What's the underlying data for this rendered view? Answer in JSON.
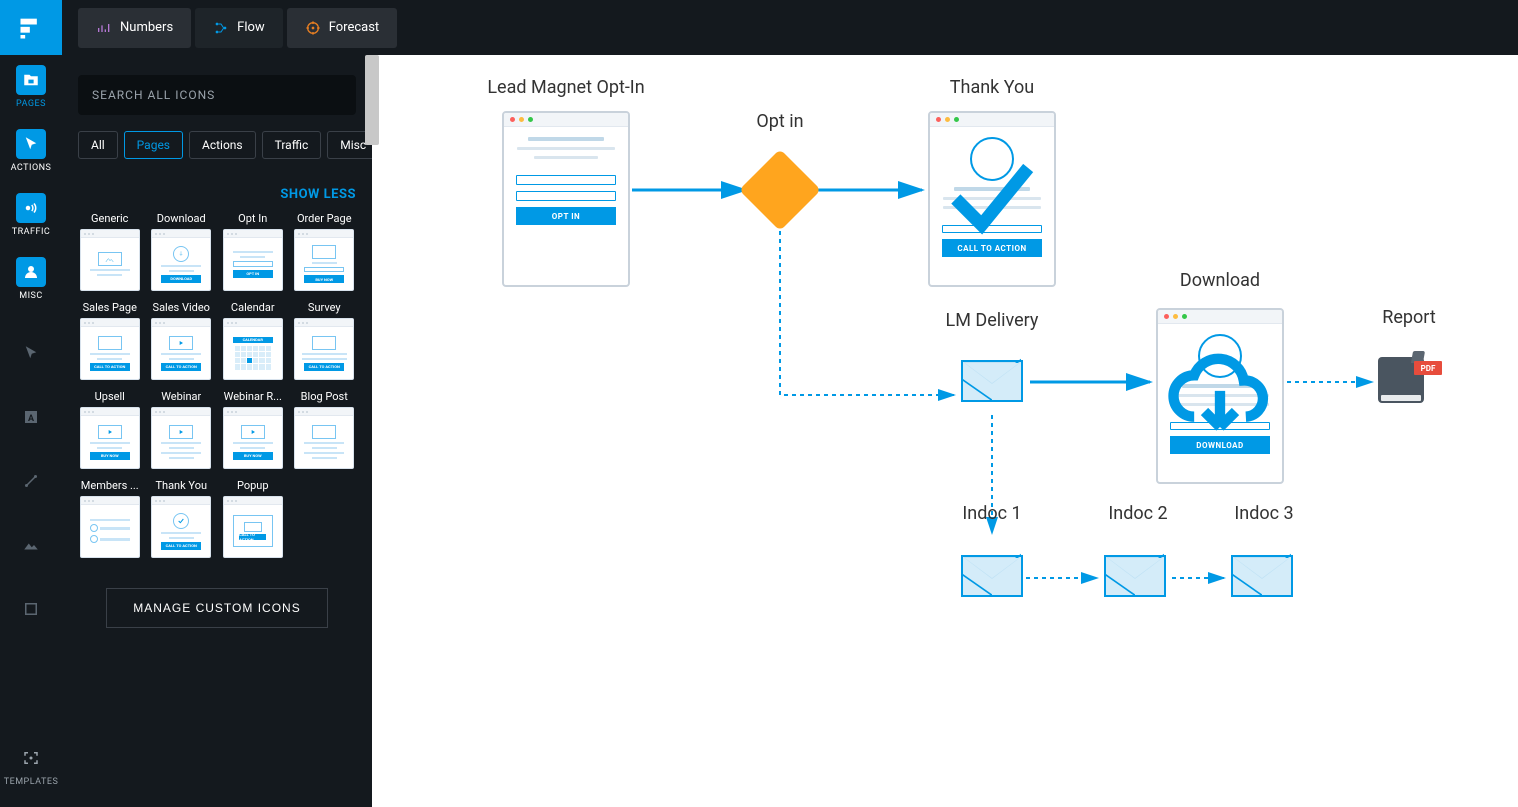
{
  "topbar": {
    "tabs": [
      {
        "label": "Numbers",
        "icon": "numbers"
      },
      {
        "label": "Flow",
        "icon": "flow"
      },
      {
        "label": "Forecast",
        "icon": "forecast"
      }
    ],
    "active": "Flow"
  },
  "rail": {
    "items": [
      {
        "label": "PAGES",
        "icon": "folder-page",
        "active": true
      },
      {
        "label": "ACTIONS",
        "icon": "folder-cursor",
        "active": false
      },
      {
        "label": "TRAFFIC",
        "icon": "folder-broadcast",
        "active": false
      },
      {
        "label": "MISC",
        "icon": "folder-person",
        "active": false
      }
    ],
    "tools": [
      {
        "name": "cursor-icon"
      },
      {
        "name": "text-icon"
      },
      {
        "name": "line-icon"
      },
      {
        "name": "image-icon"
      },
      {
        "name": "shape-icon"
      }
    ],
    "bottom": {
      "label": "TEMPLATES",
      "icon": "fullscreen"
    }
  },
  "panel": {
    "search_placeholder": "SEARCH ALL ICONS",
    "filters": [
      "All",
      "Pages",
      "Actions",
      "Traffic",
      "Misc"
    ],
    "active_filter": "Pages",
    "show_less": "SHOW LESS",
    "icons": [
      {
        "label": "Generic",
        "type": "generic"
      },
      {
        "label": "Download",
        "type": "download"
      },
      {
        "label": "Opt In",
        "type": "optin"
      },
      {
        "label": "Order Page",
        "type": "order"
      },
      {
        "label": "Sales Page",
        "type": "sales"
      },
      {
        "label": "Sales Video",
        "type": "salesvideo"
      },
      {
        "label": "Calendar",
        "type": "calendar"
      },
      {
        "label": "Survey",
        "type": "survey"
      },
      {
        "label": "Upsell",
        "type": "upsell"
      },
      {
        "label": "Webinar",
        "type": "webinar"
      },
      {
        "label": "Webinar R...",
        "type": "webinarreplay"
      },
      {
        "label": "Blog Post",
        "type": "blogpost"
      },
      {
        "label": "Members ...",
        "type": "members"
      },
      {
        "label": "Thank You",
        "type": "thankyou"
      },
      {
        "label": "Popup",
        "type": "popup"
      }
    ],
    "manage_label": "MANAGE CUSTOM ICONS"
  },
  "canvas": {
    "nodes": {
      "lead_magnet": {
        "label": "Lead Magnet Opt-In",
        "btn": "OPT IN"
      },
      "opt_in": {
        "label": "Opt in"
      },
      "thank_you": {
        "label": "Thank You",
        "btn": "CALL TO ACTION"
      },
      "lm_delivery": {
        "label": "LM Delivery"
      },
      "download": {
        "label": "Download",
        "btn": "DOWNLOAD"
      },
      "report": {
        "label": "Report",
        "badge": "PDF"
      },
      "indoc1": {
        "label": "Indoc 1"
      },
      "indoc2": {
        "label": "Indoc 2"
      },
      "indoc3": {
        "label": "Indoc 3"
      }
    }
  },
  "colors": {
    "primary": "#0099e5",
    "accent": "#ffa51e",
    "dark": "#14191e"
  }
}
